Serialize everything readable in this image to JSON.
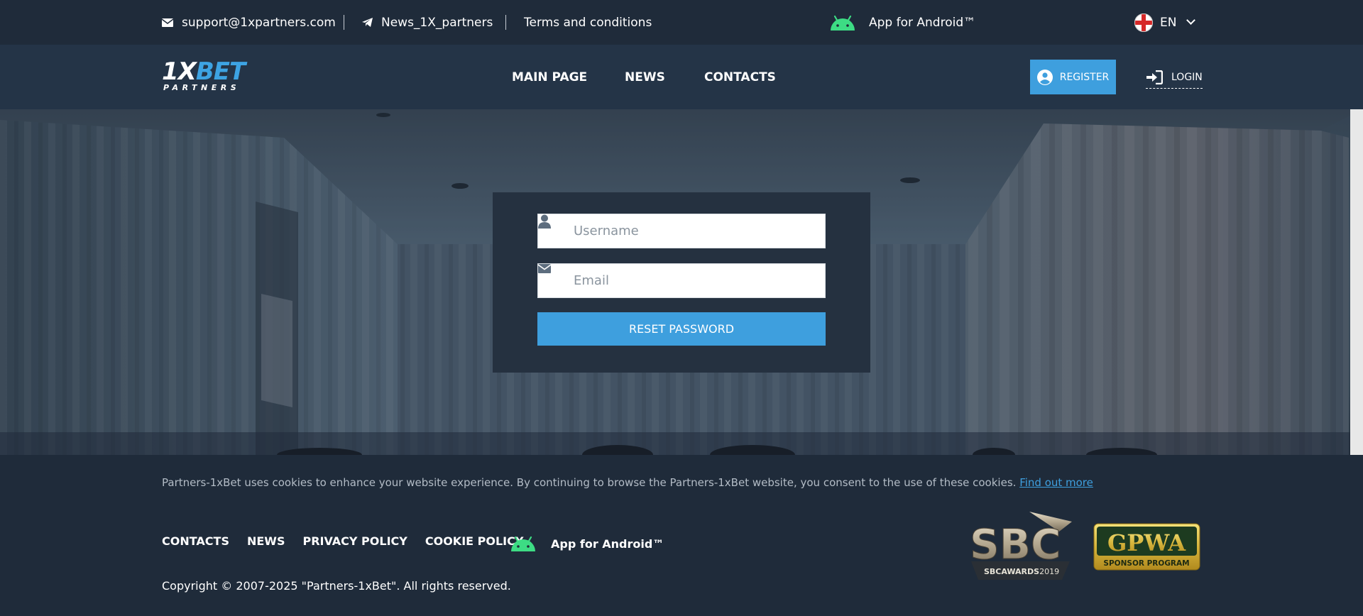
{
  "topbar": {
    "email": "support@1xpartners.com",
    "telegram": "News_1X_partners",
    "terms": "Terms and conditions",
    "android": "App for Android™",
    "language": "EN"
  },
  "header": {
    "logo_top_a": "1X",
    "logo_top_b": "BET",
    "logo_bottom": "PARTNERS",
    "nav": [
      "MAIN PAGE",
      "NEWS",
      "CONTACTS"
    ],
    "register": "REGISTER",
    "login": "LOGIN"
  },
  "form": {
    "username_placeholder": "Username",
    "email_placeholder": "Email",
    "reset_label": "RESET PASSWORD"
  },
  "footer": {
    "cookie_text": "Partners-1xBet uses cookies to enhance your website experience. By continuing to browse the Partners-1xBet website, you consent to the use of these cookies.",
    "cookie_link": "Find out more",
    "nav": [
      "CONTACTS",
      "NEWS",
      "PRIVACY POLICY",
      "COOKIE POLICY"
    ],
    "android": "App for Android™",
    "copyright": "Copyright © 2007-2025 \"Partners-1xBet\". All rights reserved.",
    "sbc_main": "SBC",
    "sbc_sub_a": "SBC",
    "sbc_sub_b": "AWARDS",
    "sbc_sub_c": "2019",
    "gpwa_main": "GPWA",
    "gpwa_sub": "SPONSOR PROGRAM"
  },
  "colors": {
    "accent": "#3e9fde",
    "topbar_bg": "#1f2b3a",
    "header_bg": "#243447",
    "panel_bg": "#253140",
    "android_green": "#3ddc84"
  },
  "icons": {
    "email": "envelope-icon",
    "telegram": "telegram-plane-icon",
    "android": "android-icon",
    "language": "uk-flag-icon",
    "register": "user-circle-icon",
    "login": "sign-in-icon",
    "username": "user-icon",
    "email_field": "envelope-icon"
  }
}
